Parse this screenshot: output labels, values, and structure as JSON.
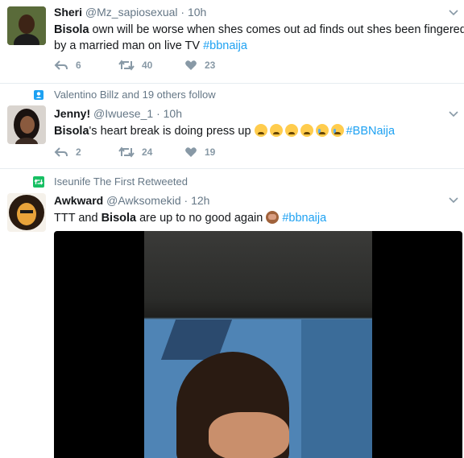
{
  "tweets": [
    {
      "name": "Sheri",
      "handle": "@Mz_sapiosexual",
      "dot": "·",
      "time": "10h",
      "text_bold": "Bisola",
      "text_rest": " own will be worse when shes comes out ad finds out shes been fingered",
      "text_line2": "by a married man on live TV ",
      "hashtag": "#bbnaija",
      "replies": "6",
      "retweets": "40",
      "likes": "23"
    },
    {
      "context": "Valentino Billz and 19 others follow",
      "name": "Jenny!",
      "handle": "@Iwuese_1",
      "dot": "·",
      "time": "10h",
      "text_bold": "Bisola",
      "text_rest": "'s heart break is doing press up ",
      "hashtag": "#BBNaija",
      "replies": "2",
      "retweets": "24",
      "likes": "19"
    },
    {
      "context": "Iseunife The First Retweeted",
      "name": "Awkward",
      "handle": "@Awksomekid",
      "dot": "·",
      "time": "12h",
      "text_pre": "TTT and ",
      "text_bold": "Bisola",
      "text_rest": " are up to no good again ",
      "hashtag": "#bbnaija"
    }
  ],
  "colors": {
    "link": "#1da1f2",
    "muted": "#657786",
    "retweet_green": "#17bf63",
    "follow_blue": "#1da1f2"
  },
  "icons": [
    "reply-icon",
    "retweet-icon",
    "like-icon",
    "chevron-down-icon",
    "follow-person-icon",
    "retweet-context-icon"
  ]
}
